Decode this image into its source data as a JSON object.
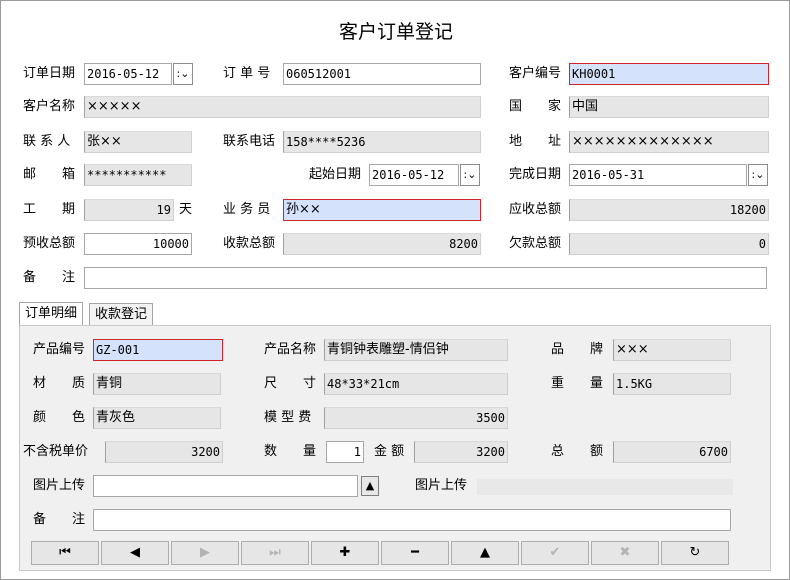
{
  "title": "客户订单登记",
  "order": {
    "date_label": "订单日期",
    "date_value": "2016-05-12",
    "number_label": "订 单 号",
    "number_value": "060512001",
    "customer_id_label": "客户编号",
    "customer_id_value": "KH0001",
    "customer_name_label": "客户名称",
    "customer_name_value": "×××××",
    "country_label": "国　　家",
    "country_value": "中国",
    "contact_label": "联 系 人",
    "contact_value": "张××",
    "phone_label": "联系电话",
    "phone_value": "158****5236",
    "address_label": "地　　址",
    "address_value": "×××××××××××××",
    "email_label": "邮　　箱",
    "email_value": "***********",
    "start_label": "起始日期",
    "start_value": "2016-05-12",
    "finish_label": "完成日期",
    "finish_value": "2016-05-31",
    "period_label": "工　　期",
    "period_value": "19",
    "period_unit": "天",
    "salesman_label": "业 务 员",
    "salesman_value": "孙××",
    "receivable_label": "应收总额",
    "receivable_value": "18200",
    "prepaid_label": "预收总额",
    "prepaid_value": "10000",
    "received_label": "收款总额",
    "received_value": "8200",
    "owed_label": "欠款总额",
    "owed_value": "0",
    "remark_label": "备　　注",
    "remark_value": ""
  },
  "tabs": [
    {
      "label": "订单明细",
      "active": true
    },
    {
      "label": "收款登记",
      "active": false
    }
  ],
  "detail": {
    "product_id_label": "产品编号",
    "product_id_value": "GZ-001",
    "product_name_label": "产品名称",
    "product_name_value": "青铜钟表雕塑-情侣钟",
    "brand_label": "品　　牌",
    "brand_value": "×××",
    "material_label": "材　　质",
    "material_value": "青铜",
    "size_label": "尺　　寸",
    "size_value": "48*33*21cm",
    "weight_label": "重　　量",
    "weight_value": "1.5KG",
    "color_label": "颜　　色",
    "color_value": "青灰色",
    "mold_fee_label": "模 型 费",
    "mold_fee_value": "3500",
    "unit_price_label": "不含税单价",
    "unit_price_value": "3200",
    "quantity_label": "数　　量",
    "quantity_value": "1",
    "amount_label": "金 额",
    "amount_value": "3200",
    "total_label": "总　　额",
    "total_value": "6700",
    "image_upload_label": "图片上传",
    "image_upload_value": "",
    "image_upload2_label": "图片上传",
    "remark_label": "备　　注",
    "remark_value": ""
  },
  "nav_buttons": [
    {
      "name": "first-record-button",
      "glyph": "⏮",
      "enabled": true
    },
    {
      "name": "prev-record-button",
      "glyph": "◀",
      "enabled": true
    },
    {
      "name": "next-record-button",
      "glyph": "▶",
      "enabled": false
    },
    {
      "name": "last-record-button",
      "glyph": "⏭",
      "enabled": false
    },
    {
      "name": "add-record-button",
      "glyph": "✚",
      "enabled": true
    },
    {
      "name": "delete-record-button",
      "glyph": "━",
      "enabled": true
    },
    {
      "name": "edit-record-button",
      "glyph": "▲",
      "enabled": true
    },
    {
      "name": "confirm-button",
      "glyph": "✔",
      "enabled": false
    },
    {
      "name": "cancel-button",
      "glyph": "✖",
      "enabled": false
    },
    {
      "name": "refresh-button",
      "glyph": "↻",
      "enabled": true
    }
  ],
  "colors": {
    "highlight_field": "#d4e3fb",
    "required_border": "#d2232a",
    "readonly_field": "#e6e6e6"
  }
}
